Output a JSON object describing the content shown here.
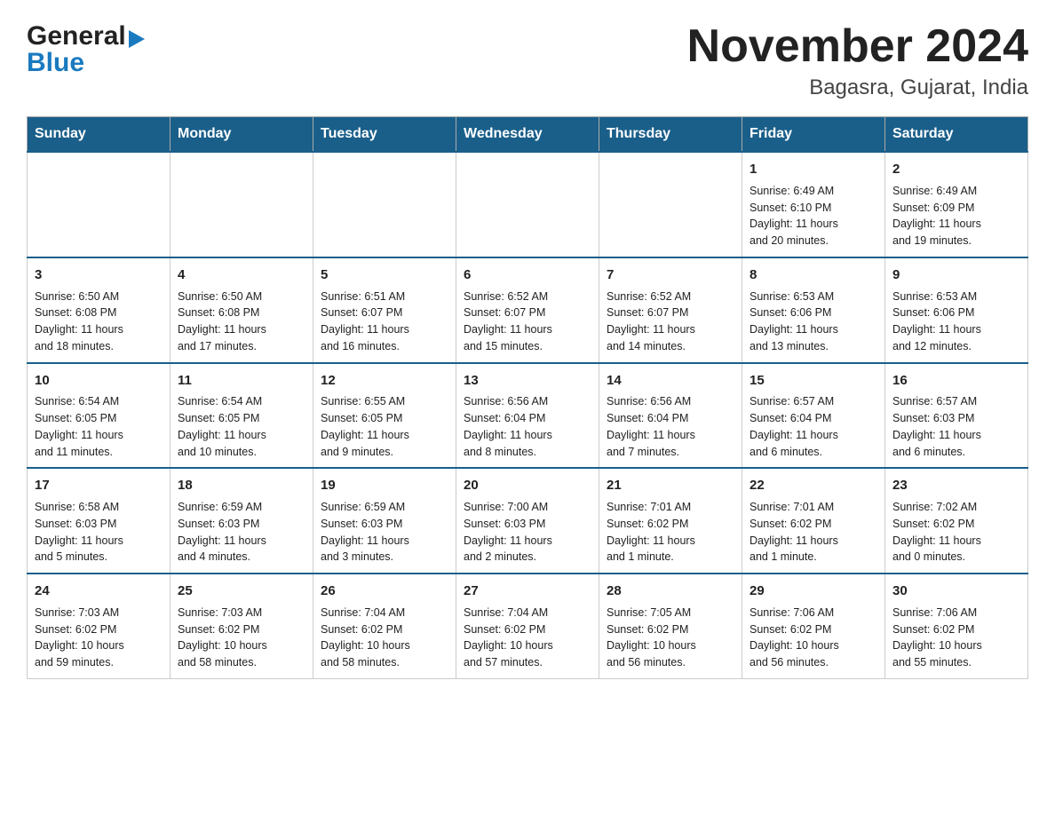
{
  "logo": {
    "general": "General",
    "blue": "Blue"
  },
  "title": "November 2024",
  "location": "Bagasra, Gujarat, India",
  "days_of_week": [
    "Sunday",
    "Monday",
    "Tuesday",
    "Wednesday",
    "Thursday",
    "Friday",
    "Saturday"
  ],
  "weeks": [
    {
      "days": [
        {
          "number": "",
          "info": ""
        },
        {
          "number": "",
          "info": ""
        },
        {
          "number": "",
          "info": ""
        },
        {
          "number": "",
          "info": ""
        },
        {
          "number": "",
          "info": ""
        },
        {
          "number": "1",
          "info": "Sunrise: 6:49 AM\nSunset: 6:10 PM\nDaylight: 11 hours\nand 20 minutes."
        },
        {
          "number": "2",
          "info": "Sunrise: 6:49 AM\nSunset: 6:09 PM\nDaylight: 11 hours\nand 19 minutes."
        }
      ]
    },
    {
      "days": [
        {
          "number": "3",
          "info": "Sunrise: 6:50 AM\nSunset: 6:08 PM\nDaylight: 11 hours\nand 18 minutes."
        },
        {
          "number": "4",
          "info": "Sunrise: 6:50 AM\nSunset: 6:08 PM\nDaylight: 11 hours\nand 17 minutes."
        },
        {
          "number": "5",
          "info": "Sunrise: 6:51 AM\nSunset: 6:07 PM\nDaylight: 11 hours\nand 16 minutes."
        },
        {
          "number": "6",
          "info": "Sunrise: 6:52 AM\nSunset: 6:07 PM\nDaylight: 11 hours\nand 15 minutes."
        },
        {
          "number": "7",
          "info": "Sunrise: 6:52 AM\nSunset: 6:07 PM\nDaylight: 11 hours\nand 14 minutes."
        },
        {
          "number": "8",
          "info": "Sunrise: 6:53 AM\nSunset: 6:06 PM\nDaylight: 11 hours\nand 13 minutes."
        },
        {
          "number": "9",
          "info": "Sunrise: 6:53 AM\nSunset: 6:06 PM\nDaylight: 11 hours\nand 12 minutes."
        }
      ]
    },
    {
      "days": [
        {
          "number": "10",
          "info": "Sunrise: 6:54 AM\nSunset: 6:05 PM\nDaylight: 11 hours\nand 11 minutes."
        },
        {
          "number": "11",
          "info": "Sunrise: 6:54 AM\nSunset: 6:05 PM\nDaylight: 11 hours\nand 10 minutes."
        },
        {
          "number": "12",
          "info": "Sunrise: 6:55 AM\nSunset: 6:05 PM\nDaylight: 11 hours\nand 9 minutes."
        },
        {
          "number": "13",
          "info": "Sunrise: 6:56 AM\nSunset: 6:04 PM\nDaylight: 11 hours\nand 8 minutes."
        },
        {
          "number": "14",
          "info": "Sunrise: 6:56 AM\nSunset: 6:04 PM\nDaylight: 11 hours\nand 7 minutes."
        },
        {
          "number": "15",
          "info": "Sunrise: 6:57 AM\nSunset: 6:04 PM\nDaylight: 11 hours\nand 6 minutes."
        },
        {
          "number": "16",
          "info": "Sunrise: 6:57 AM\nSunset: 6:03 PM\nDaylight: 11 hours\nand 6 minutes."
        }
      ]
    },
    {
      "days": [
        {
          "number": "17",
          "info": "Sunrise: 6:58 AM\nSunset: 6:03 PM\nDaylight: 11 hours\nand 5 minutes."
        },
        {
          "number": "18",
          "info": "Sunrise: 6:59 AM\nSunset: 6:03 PM\nDaylight: 11 hours\nand 4 minutes."
        },
        {
          "number": "19",
          "info": "Sunrise: 6:59 AM\nSunset: 6:03 PM\nDaylight: 11 hours\nand 3 minutes."
        },
        {
          "number": "20",
          "info": "Sunrise: 7:00 AM\nSunset: 6:03 PM\nDaylight: 11 hours\nand 2 minutes."
        },
        {
          "number": "21",
          "info": "Sunrise: 7:01 AM\nSunset: 6:02 PM\nDaylight: 11 hours\nand 1 minute."
        },
        {
          "number": "22",
          "info": "Sunrise: 7:01 AM\nSunset: 6:02 PM\nDaylight: 11 hours\nand 1 minute."
        },
        {
          "number": "23",
          "info": "Sunrise: 7:02 AM\nSunset: 6:02 PM\nDaylight: 11 hours\nand 0 minutes."
        }
      ]
    },
    {
      "days": [
        {
          "number": "24",
          "info": "Sunrise: 7:03 AM\nSunset: 6:02 PM\nDaylight: 10 hours\nand 59 minutes."
        },
        {
          "number": "25",
          "info": "Sunrise: 7:03 AM\nSunset: 6:02 PM\nDaylight: 10 hours\nand 58 minutes."
        },
        {
          "number": "26",
          "info": "Sunrise: 7:04 AM\nSunset: 6:02 PM\nDaylight: 10 hours\nand 58 minutes."
        },
        {
          "number": "27",
          "info": "Sunrise: 7:04 AM\nSunset: 6:02 PM\nDaylight: 10 hours\nand 57 minutes."
        },
        {
          "number": "28",
          "info": "Sunrise: 7:05 AM\nSunset: 6:02 PM\nDaylight: 10 hours\nand 56 minutes."
        },
        {
          "number": "29",
          "info": "Sunrise: 7:06 AM\nSunset: 6:02 PM\nDaylight: 10 hours\nand 56 minutes."
        },
        {
          "number": "30",
          "info": "Sunrise: 7:06 AM\nSunset: 6:02 PM\nDaylight: 10 hours\nand 55 minutes."
        }
      ]
    }
  ]
}
